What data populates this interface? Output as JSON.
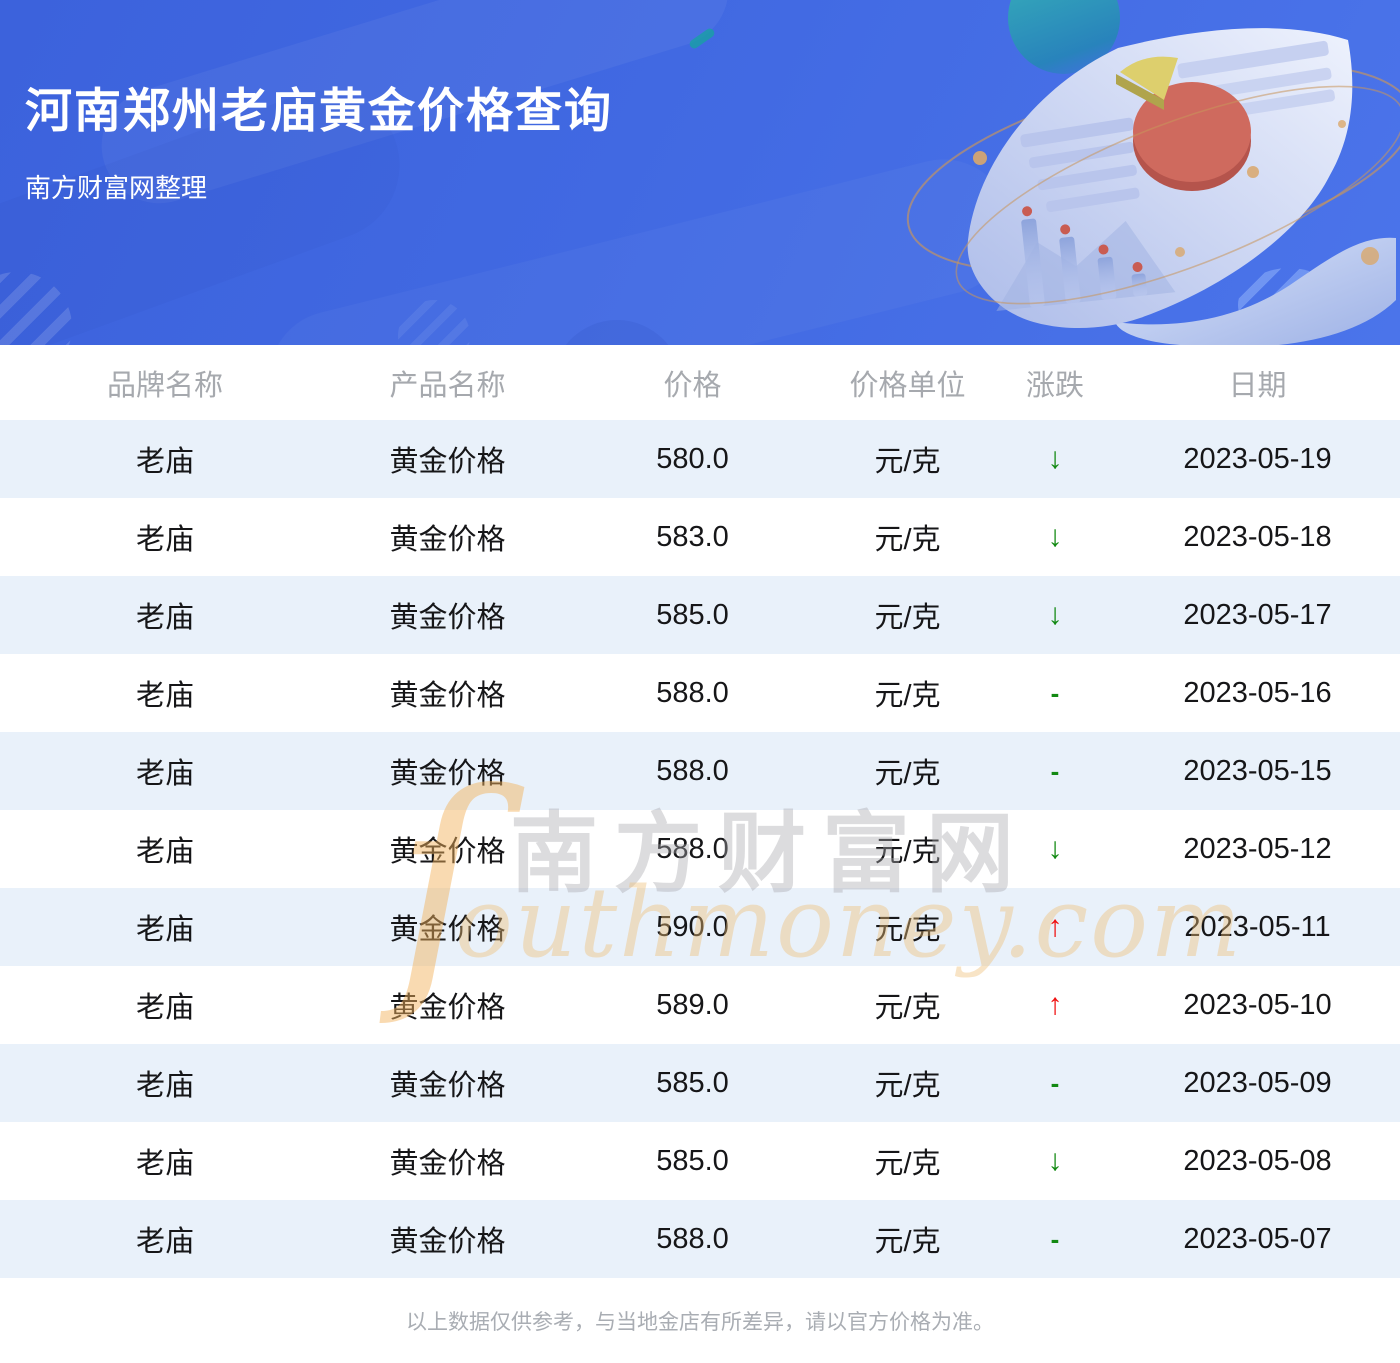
{
  "banner": {
    "title": "河南郑州老庙黄金价格查询",
    "subtitle": "南方财富网整理",
    "background_color": "#4169e2",
    "illustration": "financial-report-with-pie-chart"
  },
  "watermark": {
    "swirl": "ſ",
    "line1": "南方财富网",
    "line2": "outhmoney.com"
  },
  "table": {
    "columns": [
      {
        "key": "brand",
        "label": "品牌名称"
      },
      {
        "key": "product",
        "label": "产品名称"
      },
      {
        "key": "price",
        "label": "价格"
      },
      {
        "key": "unit",
        "label": "价格单位"
      },
      {
        "key": "change",
        "label": "涨跌"
      },
      {
        "key": "date",
        "label": "日期"
      }
    ],
    "rows": [
      {
        "brand": "老庙",
        "product": "黄金价格",
        "price": "580.0",
        "unit": "元/克",
        "change": {
          "symbol": "↓",
          "direction": "down"
        },
        "date": "2023-05-19"
      },
      {
        "brand": "老庙",
        "product": "黄金价格",
        "price": "583.0",
        "unit": "元/克",
        "change": {
          "symbol": "↓",
          "direction": "down"
        },
        "date": "2023-05-18"
      },
      {
        "brand": "老庙",
        "product": "黄金价格",
        "price": "585.0",
        "unit": "元/克",
        "change": {
          "symbol": "↓",
          "direction": "down"
        },
        "date": "2023-05-17"
      },
      {
        "brand": "老庙",
        "product": "黄金价格",
        "price": "588.0",
        "unit": "元/克",
        "change": {
          "symbol": "-",
          "direction": "flat"
        },
        "date": "2023-05-16"
      },
      {
        "brand": "老庙",
        "product": "黄金价格",
        "price": "588.0",
        "unit": "元/克",
        "change": {
          "symbol": "-",
          "direction": "flat"
        },
        "date": "2023-05-15"
      },
      {
        "brand": "老庙",
        "product": "黄金价格",
        "price": "588.0",
        "unit": "元/克",
        "change": {
          "symbol": "↓",
          "direction": "down"
        },
        "date": "2023-05-12"
      },
      {
        "brand": "老庙",
        "product": "黄金价格",
        "price": "590.0",
        "unit": "元/克",
        "change": {
          "symbol": "↑",
          "direction": "up"
        },
        "date": "2023-05-11"
      },
      {
        "brand": "老庙",
        "product": "黄金价格",
        "price": "589.0",
        "unit": "元/克",
        "change": {
          "symbol": "↑",
          "direction": "up"
        },
        "date": "2023-05-10"
      },
      {
        "brand": "老庙",
        "product": "黄金价格",
        "price": "585.0",
        "unit": "元/克",
        "change": {
          "symbol": "-",
          "direction": "flat"
        },
        "date": "2023-05-09"
      },
      {
        "brand": "老庙",
        "product": "黄金价格",
        "price": "585.0",
        "unit": "元/克",
        "change": {
          "symbol": "↓",
          "direction": "down"
        },
        "date": "2023-05-08"
      },
      {
        "brand": "老庙",
        "product": "黄金价格",
        "price": "588.0",
        "unit": "元/克",
        "change": {
          "symbol": "-",
          "direction": "flat"
        },
        "date": "2023-05-07"
      }
    ]
  },
  "footer": {
    "note": "以上数据仅供参考，与当地金店有所差异，请以官方价格为准。"
  },
  "colors": {
    "banner_blue": "#4169e2",
    "row_alt_background": "#e9f1fa",
    "up_red": "#f01111",
    "down_green": "#128912",
    "header_text_gray": "#a6a9ae",
    "watermark_tan": "#e8b06a"
  }
}
